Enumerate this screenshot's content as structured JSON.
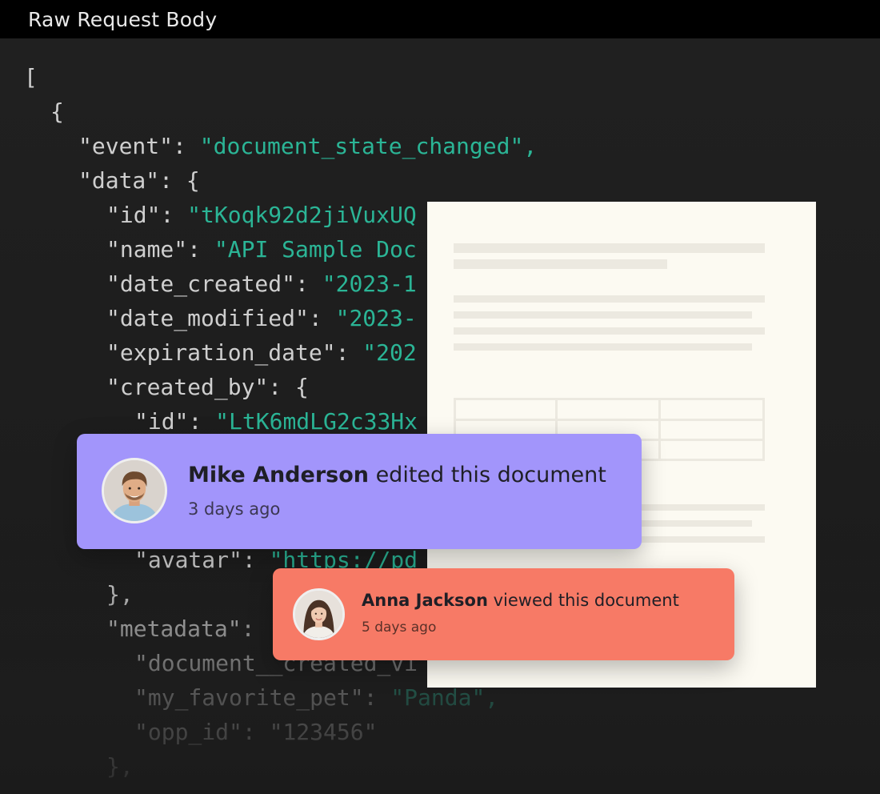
{
  "window": {
    "title": "Raw Request Body"
  },
  "code": {
    "lines": [
      {
        "key": "[",
        "sep": "",
        "value": ""
      },
      {
        "key": "{",
        "sep": "",
        "value": ""
      },
      {
        "key": "\"event\"",
        "sep": ": ",
        "value": "\"document_state_changed\","
      },
      {
        "key": "\"data\"",
        "sep": ": {",
        "value": ""
      },
      {
        "key": "\"id\"",
        "sep": ": ",
        "value": "\"tKoqk92d2jiVuxUQ"
      },
      {
        "key": "\"name\"",
        "sep": ": ",
        "value": "\"API Sample Doc"
      },
      {
        "key": "\"date_created\"",
        "sep": ": ",
        "value": "\"2023-1"
      },
      {
        "key": "\"date_modified\"",
        "sep": ": ",
        "value": "\"2023-"
      },
      {
        "key": "\"expiration_date\"",
        "sep": ": ",
        "value": "\"202"
      },
      {
        "key": "\"created_by\"",
        "sep": ": {",
        "value": ""
      },
      {
        "key": "\"id\"",
        "sep": ": ",
        "value": "\"LtK6mdLG2c33Hx"
      },
      {
        "key": "\"avatar\"",
        "sep": ": ",
        "value": "\"https://pd"
      },
      {
        "key": "},",
        "sep": "",
        "value": ""
      },
      {
        "key": "\"metadata\"",
        "sep": ": ",
        "value": ""
      },
      {
        "key": "\"document__created_vi",
        "sep": "",
        "value": ""
      },
      {
        "key": "\"my_favorite_pet\"",
        "sep": ": ",
        "value": "\"Panda\","
      },
      {
        "key": "\"opp_id\"",
        "sep": ": ",
        "value": "\"123456\""
      },
      {
        "key": "},",
        "sep": "",
        "value": ""
      }
    ]
  },
  "notifications": [
    {
      "name": "Mike Anderson",
      "action": " edited this document",
      "time": "3 days ago",
      "avatar": "man-avatar-icon"
    },
    {
      "name": "Anna Jackson",
      "action": " viewed this document",
      "time": "5 days ago",
      "avatar": "woman-avatar-icon"
    }
  ],
  "colors": {
    "code_string": "#2bb596",
    "mike_card": "#a295fb",
    "anna_card": "#f77a66",
    "document_paper": "#fcfaf2"
  }
}
